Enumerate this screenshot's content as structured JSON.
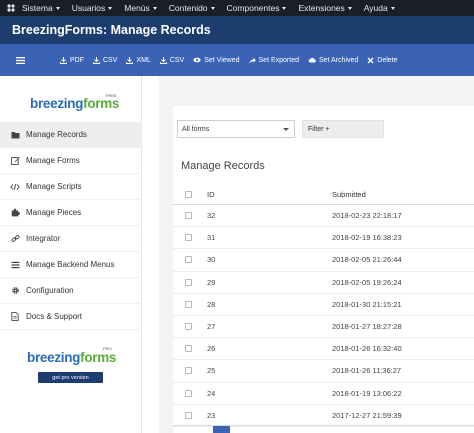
{
  "topbar": {
    "items": [
      {
        "label": "Sistema"
      },
      {
        "label": "Usuarios"
      },
      {
        "label": "Menús"
      },
      {
        "label": "Contenido"
      },
      {
        "label": "Componentes"
      },
      {
        "label": "Extensiones"
      },
      {
        "label": "Ayuda"
      }
    ]
  },
  "titlebar": {
    "title": "BreezingForms: Manage Records"
  },
  "toolbar": {
    "buttons": [
      {
        "label": "PDF",
        "icon": "download-icon"
      },
      {
        "label": "CSV",
        "icon": "download-icon"
      },
      {
        "label": "XML",
        "icon": "download-icon"
      },
      {
        "label": "CSV",
        "icon": "download-icon"
      },
      {
        "label": "Set Viewed",
        "icon": "eye-icon"
      },
      {
        "label": "Set Exported",
        "icon": "share-icon"
      },
      {
        "label": "Set Archived",
        "icon": "cloud-icon"
      },
      {
        "label": "Delete",
        "icon": "close-icon"
      }
    ]
  },
  "sidebar": {
    "logo": {
      "part1": "breezing",
      "part2": "forms",
      "tag": "FREE"
    },
    "items": [
      {
        "label": "Manage Records",
        "icon": "folder-icon",
        "active": true
      },
      {
        "label": "Manage Forms",
        "icon": "edit-icon"
      },
      {
        "label": "Manage Scripts",
        "icon": "code-icon"
      },
      {
        "label": "Manage Pieces",
        "icon": "puzzle-icon"
      },
      {
        "label": "Integrator",
        "icon": "link-icon"
      },
      {
        "label": "Manage Backend Menus",
        "icon": "list-icon"
      },
      {
        "label": "Configuration",
        "icon": "gear-icon"
      },
      {
        "label": "Docs & Support",
        "icon": "document-icon"
      }
    ],
    "pro_logo": {
      "part1": "breezing",
      "part2": "forms",
      "tag": "PRO"
    },
    "pro_button": "get pro version"
  },
  "main": {
    "form_select": "All forms",
    "filter_label": "Filter +",
    "heading": "Manage Records",
    "columns": {
      "id": "ID",
      "submitted": "Submitted"
    },
    "rows": [
      {
        "id": "32",
        "submitted": "2018-02-23 22:18:17"
      },
      {
        "id": "31",
        "submitted": "2018-02-19 16:38:23"
      },
      {
        "id": "30",
        "submitted": "2018-02-05 21:26:44"
      },
      {
        "id": "29",
        "submitted": "2018-02-05 19:26:24"
      },
      {
        "id": "28",
        "submitted": "2018-01-30 21:15:21"
      },
      {
        "id": "27",
        "submitted": "2018-01-27 18:27:28"
      },
      {
        "id": "26",
        "submitted": "2018-01-26 16:32:40"
      },
      {
        "id": "25",
        "submitted": "2018-01-26 11:36:27"
      },
      {
        "id": "24",
        "submitted": "2018-01-19 13:06:22"
      },
      {
        "id": "23",
        "submitted": "2017-12-27 21:59:39"
      }
    ]
  },
  "colors": {
    "topbar": "#1a1e29",
    "titlebar": "#1c3d6e",
    "toolbar": "#3a63b5",
    "logo_blue": "#2a6bb8",
    "logo_green": "#5aab3c"
  }
}
